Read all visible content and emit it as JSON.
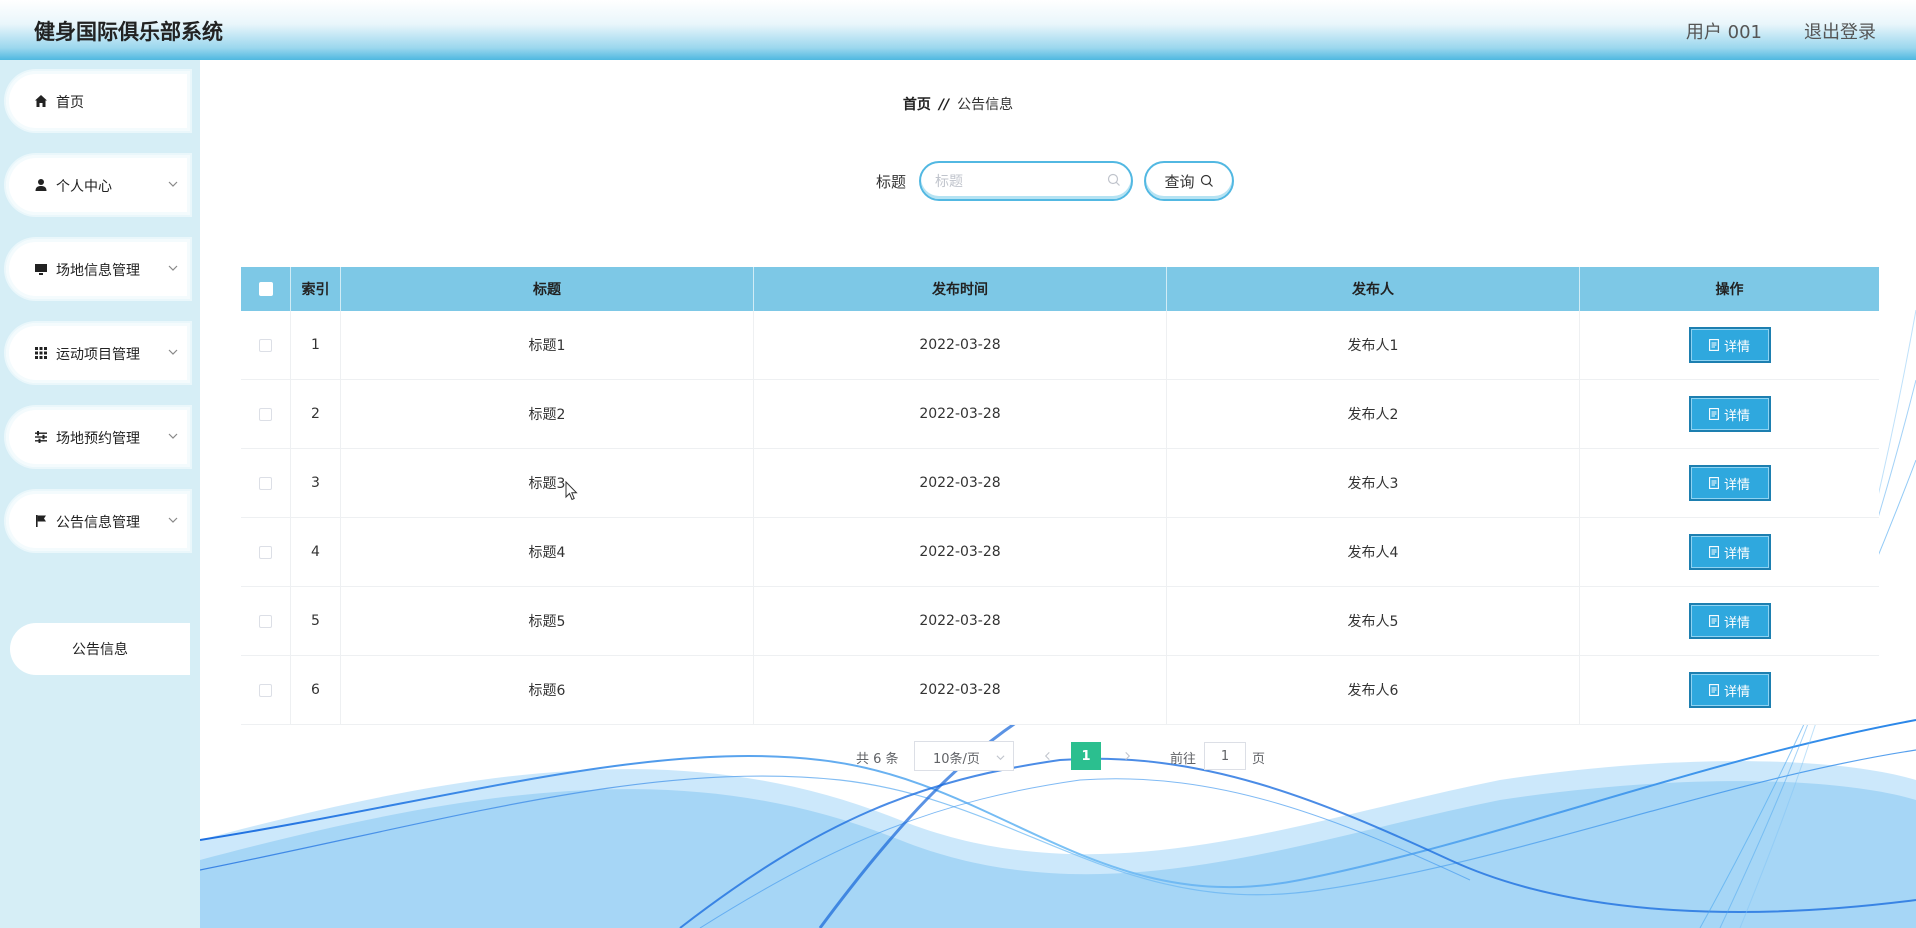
{
  "header": {
    "app_title": "健身国际俱乐部系统",
    "user_label": "用户 001",
    "logout_label": "退出登录"
  },
  "sidebar": {
    "items": [
      {
        "label": "首页",
        "icon": "home-icon"
      },
      {
        "label": "个人中心",
        "icon": "user-icon"
      },
      {
        "label": "场地信息管理",
        "icon": "monitor-icon"
      },
      {
        "label": "运动项目管理",
        "icon": "grid-icon"
      },
      {
        "label": "场地预约管理",
        "icon": "sliders-icon"
      },
      {
        "label": "公告信息管理",
        "icon": "flag-icon"
      }
    ],
    "sub_item": "公告信息"
  },
  "breadcrumb": {
    "home": "首页",
    "separator": "//",
    "current": "公告信息"
  },
  "search": {
    "label": "标题",
    "placeholder": "标题",
    "value": "",
    "button_label": "查询"
  },
  "table": {
    "headers": {
      "index": "索引",
      "title": "标题",
      "time": "发布时间",
      "publisher": "发布人",
      "actions": "操作"
    },
    "rows": [
      {
        "index": "1",
        "title": "标题1",
        "time": "2022-03-28",
        "publisher": "发布人1"
      },
      {
        "index": "2",
        "title": "标题2",
        "time": "2022-03-28",
        "publisher": "发布人2"
      },
      {
        "index": "3",
        "title": "标题3",
        "time": "2022-03-28",
        "publisher": "发布人3"
      },
      {
        "index": "4",
        "title": "标题4",
        "time": "2022-03-28",
        "publisher": "发布人4"
      },
      {
        "index": "5",
        "title": "标题5",
        "time": "2022-03-28",
        "publisher": "发布人5"
      },
      {
        "index": "6",
        "title": "标题6",
        "time": "2022-03-28",
        "publisher": "发布人6"
      }
    ],
    "detail_label": "详情"
  },
  "pagination": {
    "total": "共 6 条",
    "page_size": "10条/页",
    "current_page": "1",
    "goto_label": "前往",
    "goto_value": "1",
    "page_suffix": "页"
  },
  "colors": {
    "accent": "#7dc8e6",
    "button": "#2fa8de",
    "active_page": "#2bbf8f"
  }
}
